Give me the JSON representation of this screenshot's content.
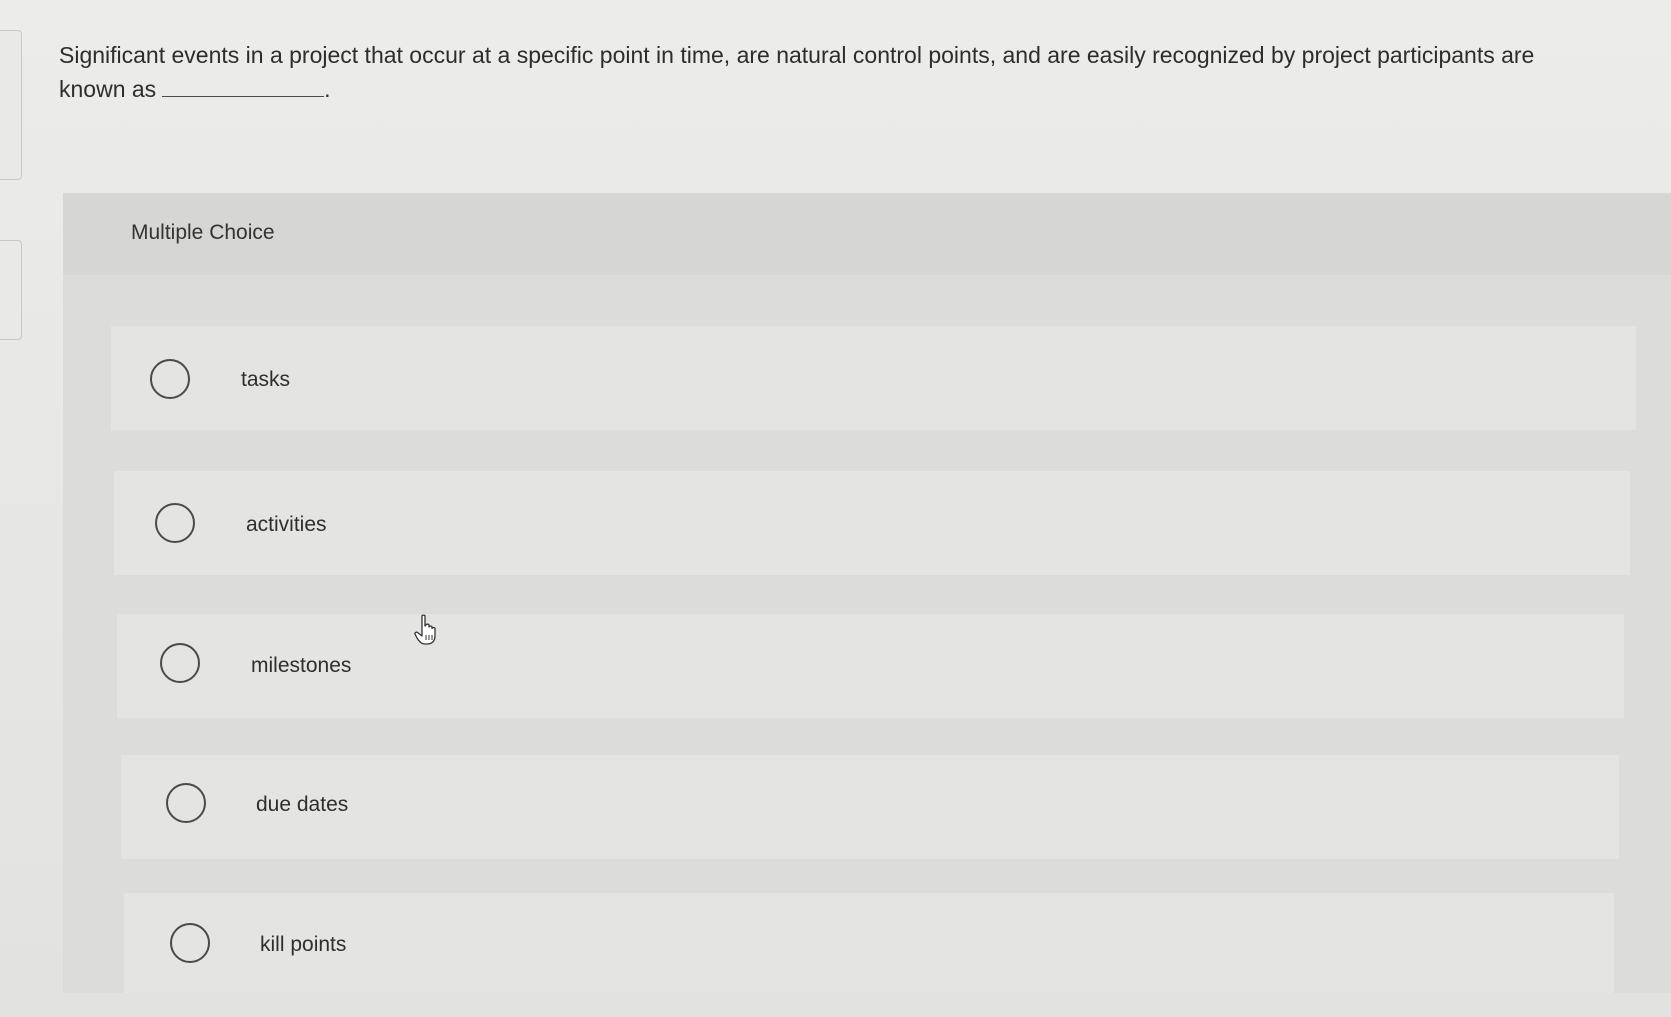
{
  "question": {
    "text_line1": "Significant events in a project that occur at a specific point in time, are natural control points, and are easily recognized by project participants are",
    "text_line2": "known as",
    "blank_suffix": "."
  },
  "multiple_choice": {
    "title": "Multiple Choice",
    "options": [
      {
        "label": "tasks",
        "selected": false
      },
      {
        "label": "activities",
        "selected": false
      },
      {
        "label": "milestones",
        "selected": false
      },
      {
        "label": "due dates",
        "selected": false
      },
      {
        "label": "kill points",
        "selected": false
      }
    ]
  },
  "icons": {
    "cursor": "hand-pointer-icon"
  }
}
